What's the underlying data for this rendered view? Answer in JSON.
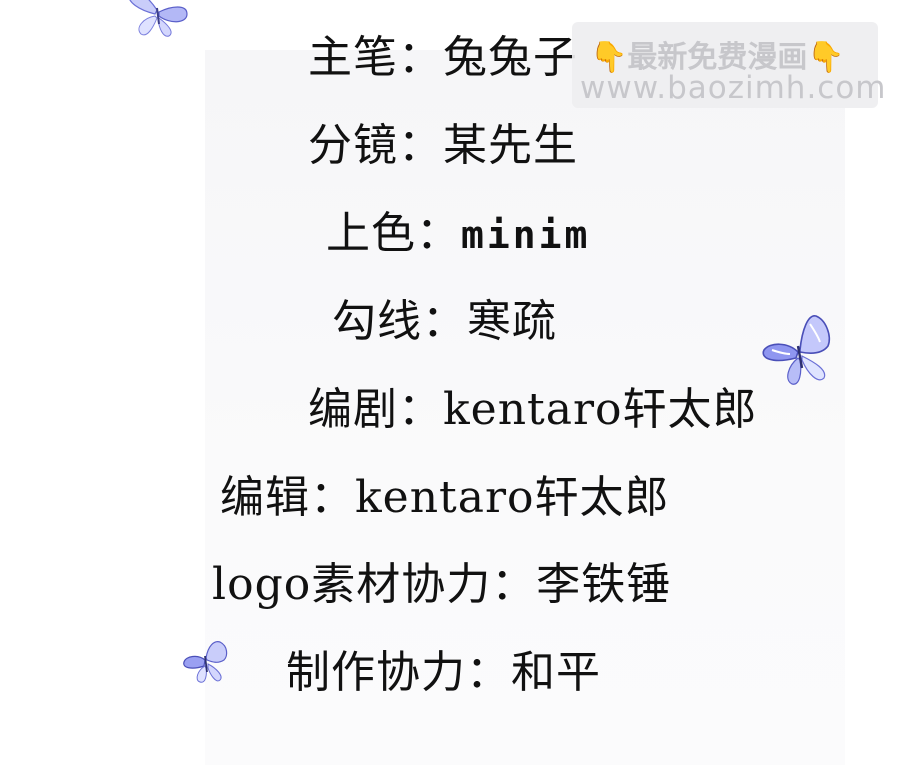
{
  "credits": [
    {
      "label": "主笔：",
      "value": "兔兔子"
    },
    {
      "label": "分镜：",
      "value": "某先生"
    },
    {
      "label": "上色：",
      "value": "minim"
    },
    {
      "label": "勾线：",
      "value": "寒疏"
    },
    {
      "label": "编剧：",
      "value": "kentaro轩太郎"
    },
    {
      "label": "编辑：",
      "value": "kentaro轩太郎"
    },
    {
      "label": "logo素材协力：",
      "value": "李铁锤"
    },
    {
      "label": "制作协力：",
      "value": "和平"
    }
  ],
  "watermark": {
    "line1": "最新免费漫画",
    "hand_left": "👇",
    "hand_right": "👇",
    "line2": "www.baozimh.com"
  },
  "decorations": {
    "butterfly_icon": "butterfly-icon",
    "colors": {
      "wing_light": "#dfe4ff",
      "wing_mid": "#8f96f0",
      "wing_dark": "#4a4fb8"
    }
  }
}
